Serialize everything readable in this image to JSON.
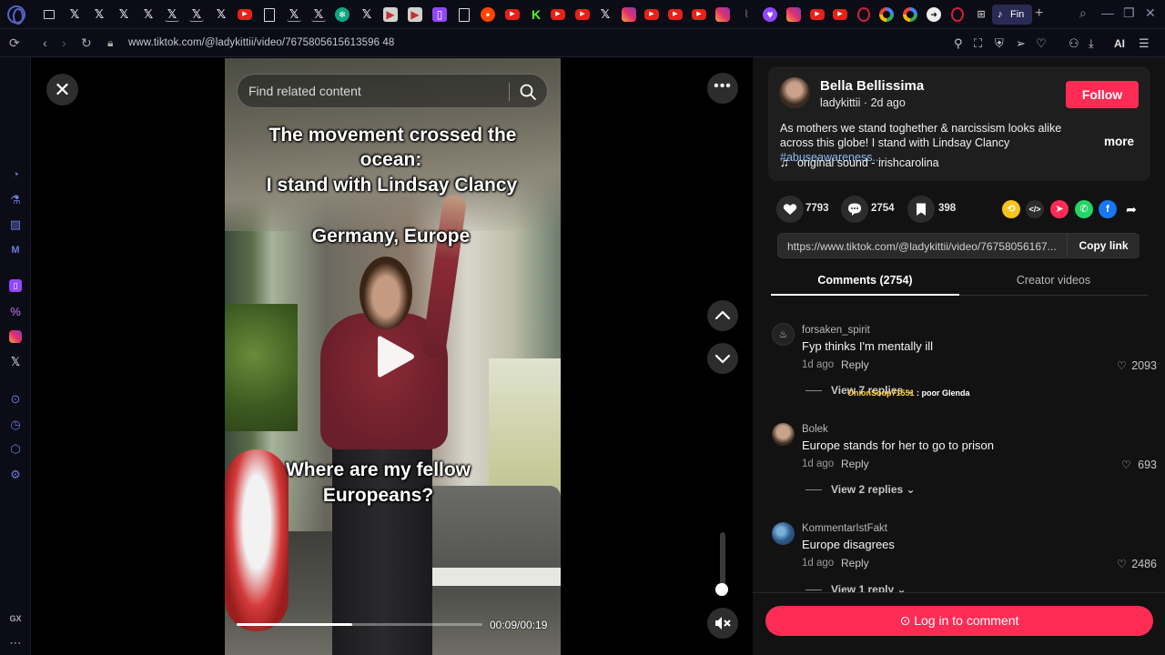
{
  "browser": {
    "url": "www.tiktok.com/@ladykittii/video/7675805615613596 48",
    "active_tab_label": "Fin",
    "ai_label": "AI"
  },
  "search": {
    "placeholder": "Find related content"
  },
  "video": {
    "captions": [
      "The movement crossed the",
      "ocean:",
      "I stand with Lindsay Clancy",
      "Germany, Europe",
      "Where are my fellow",
      "Europeans?"
    ],
    "time": "00:09/00:19",
    "progress": 0.47,
    "volume": 0.2
  },
  "author": {
    "name": "Bella Bellissima",
    "handle_meta": "ladykittii · 2d ago",
    "follow_label": "Follow",
    "description": "As mothers we stand toghether & narcissism looks alike across this globe! I stand with Lindsay Clancy ",
    "hashtag": "#abuseawareness...",
    "more_label": "more",
    "sound": "original sound - irishcarolina"
  },
  "stats": {
    "likes": "7793",
    "comments": "2754",
    "saves": "398"
  },
  "share": {
    "link": "https://www.tiktok.com/@ladykittii/video/76758056167...",
    "copy_label": "Copy link"
  },
  "tabs": {
    "comments": "Comments (2754)",
    "creator": "Creator videos"
  },
  "comments": [
    {
      "user": "forsaken_spirit",
      "text": "Fyp thinks I'm mentally ill",
      "time": "1d ago",
      "reply": "Reply",
      "likes": "2093",
      "view": "View 7 replies"
    },
    {
      "user": "Bolek",
      "text": "Europe stands for her to go to prison",
      "time": "1d ago",
      "reply": "Reply",
      "likes": "693",
      "view": "View 2 replies"
    },
    {
      "user": "KommentarIstFakt",
      "text": "Europe disagrees",
      "time": "1d ago",
      "reply": "Reply",
      "likes": "2486",
      "view": "View 1 reply"
    }
  ],
  "overlay_note": {
    "user": "OnionSoup71551",
    "text": " : poor Glenda"
  },
  "login_label": "Log in to comment",
  "colors": {
    "accent": "#fe2c55",
    "hashtag": "#8fbaf5",
    "browser_bg": "#0c0c16"
  }
}
